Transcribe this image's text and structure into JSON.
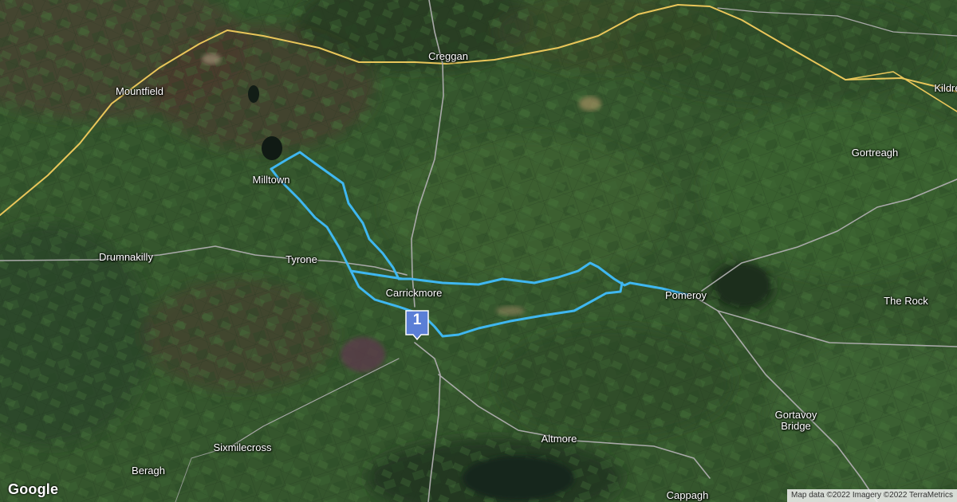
{
  "map": {
    "places": [
      {
        "id": "mountfield",
        "name": "Mountfield"
      },
      {
        "id": "creggan",
        "name": "Creggan"
      },
      {
        "id": "kildress",
        "name": "Kildre"
      },
      {
        "id": "gortreagh",
        "name": "Gortreagh"
      },
      {
        "id": "milltown",
        "name": "Milltown"
      },
      {
        "id": "drumnakilly",
        "name": "Drumnakilly"
      },
      {
        "id": "tyrone",
        "name": "Tyrone"
      },
      {
        "id": "carrickmore",
        "name": "Carrickmore"
      },
      {
        "id": "pomeroy",
        "name": "Pomeroy"
      },
      {
        "id": "therock",
        "name": "The Rock"
      },
      {
        "id": "gortavoy",
        "name": "Gortavoy Bridge"
      },
      {
        "id": "altmore",
        "name": "Altmore"
      },
      {
        "id": "sixmilecross",
        "name": "Sixmilecross"
      },
      {
        "id": "beragh",
        "name": "Beragh"
      },
      {
        "id": "cappagh",
        "name": "Cappagh"
      }
    ],
    "marker": {
      "label": "1",
      "color": "#5b7fd6"
    },
    "route_color": "#3fb7f0",
    "road_major_color": "#e9c65a",
    "road_minor_color": "#a9a9a9"
  },
  "logo": {
    "text": "Google"
  },
  "attribution": {
    "text": "Map data ©2022 Imagery ©2022 TerraMetrics"
  }
}
